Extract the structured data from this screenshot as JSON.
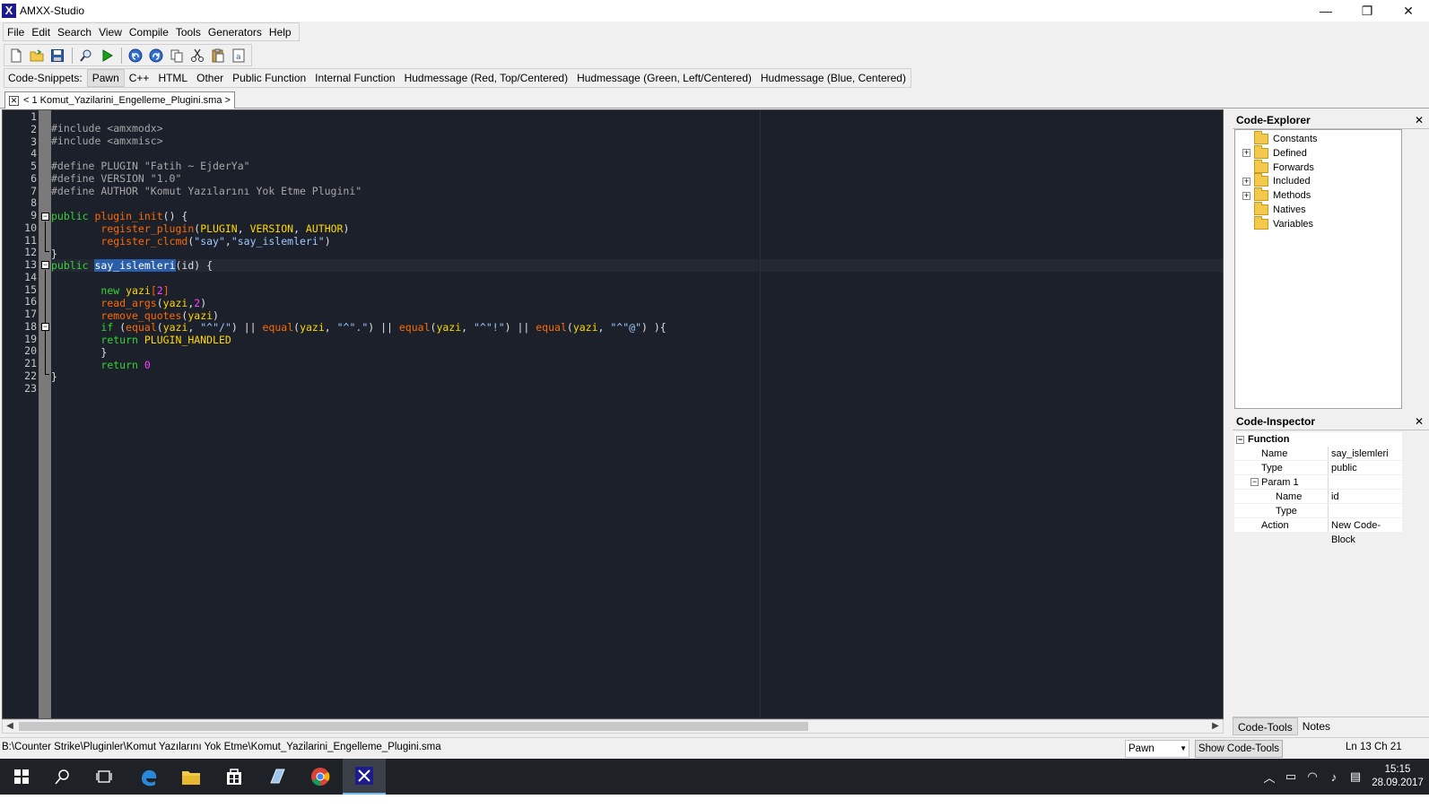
{
  "window": {
    "title": "AMXX-Studio",
    "app_icon": "X",
    "minimize": "—",
    "maximize": "❐",
    "close": "✕"
  },
  "menu": [
    "File",
    "Edit",
    "Search",
    "View",
    "Compile",
    "Tools",
    "Generators",
    "Help"
  ],
  "toolbar_icons": [
    "new-file-icon",
    "open-folder-icon",
    "save-icon",
    "find-icon",
    "run-icon",
    "undo-icon",
    "redo-icon",
    "copy-icon",
    "cut-icon",
    "paste-icon",
    "select-all-icon"
  ],
  "snippets": {
    "label": "Code-Snippets:",
    "items": [
      "Pawn",
      "C++",
      "HTML",
      "Other",
      "Public Function",
      "Internal Function",
      "Hudmessage (Red, Top/Centered)",
      "Hudmessage (Green, Left/Centered)",
      "Hudmessage (Blue, Centered)"
    ],
    "active": "Pawn"
  },
  "tab": {
    "close": "✕",
    "label": "< 1 Komut_Yazilarini_Engelleme_Plugini.sma >"
  },
  "code_lines": [
    "",
    "#include <amxmodx>",
    "#include <amxmisc>",
    "",
    "#define PLUGIN \"Fatih ~ EjderYa\"",
    "#define VERSION \"1.0\"",
    "#define AUTHOR \"Komut Yazılarını Yok Etme Plugini\"",
    "",
    "public plugin_init() {",
    "        register_plugin(PLUGIN, VERSION, AUTHOR)",
    "        register_clcmd(\"say\",\"say_islemleri\")",
    "}",
    "public say_islemleri(id) {",
    "",
    "        new yazi[2]",
    "        read_args(yazi,2)",
    "        remove_quotes(yazi)",
    "        if (equal(yazi, \"^\"/\") || equal(yazi, \"^\".\") || equal(yazi, \"^\"!\") || equal(yazi, \"^\"@\") ){",
    "        return PLUGIN_HANDLED",
    "        }",
    "        return 0",
    "}",
    ""
  ],
  "code_explorer": {
    "title": "Code-Explorer",
    "close": "✕",
    "items": [
      {
        "label": "Constants",
        "expandable": false
      },
      {
        "label": "Defined",
        "expandable": true
      },
      {
        "label": "Forwards",
        "expandable": false
      },
      {
        "label": "Included",
        "expandable": true
      },
      {
        "label": "Methods",
        "expandable": true
      },
      {
        "label": "Natives",
        "expandable": false
      },
      {
        "label": "Variables",
        "expandable": false
      }
    ]
  },
  "code_inspector": {
    "title": "Code-Inspector",
    "close": "✕",
    "section": "Function",
    "rows": [
      {
        "key": "Name",
        "value": "say_islemleri",
        "indent": 1
      },
      {
        "key": "Type",
        "value": "public",
        "indent": 1
      },
      {
        "key": "Param 1",
        "value": "",
        "indent": 1,
        "expander": true
      },
      {
        "key": "Name",
        "value": "id",
        "indent": 2
      },
      {
        "key": "Type",
        "value": "",
        "indent": 2
      },
      {
        "key": "Action",
        "value": "New Code-Block",
        "indent": 1
      }
    ]
  },
  "side_tabs": [
    "Code-Tools",
    "Notes"
  ],
  "status": {
    "path": "B:\\Counter Strike\\Pluginler\\Komut Yazılarını Yok Etme\\Komut_Yazilarini_Engelleme_Plugini.sma",
    "language": "Pawn",
    "show_tools": "Show Code-Tools",
    "position": "Ln 13 Ch 21"
  },
  "taskbar": {
    "time": "15:15",
    "date": "28.09.2017"
  }
}
